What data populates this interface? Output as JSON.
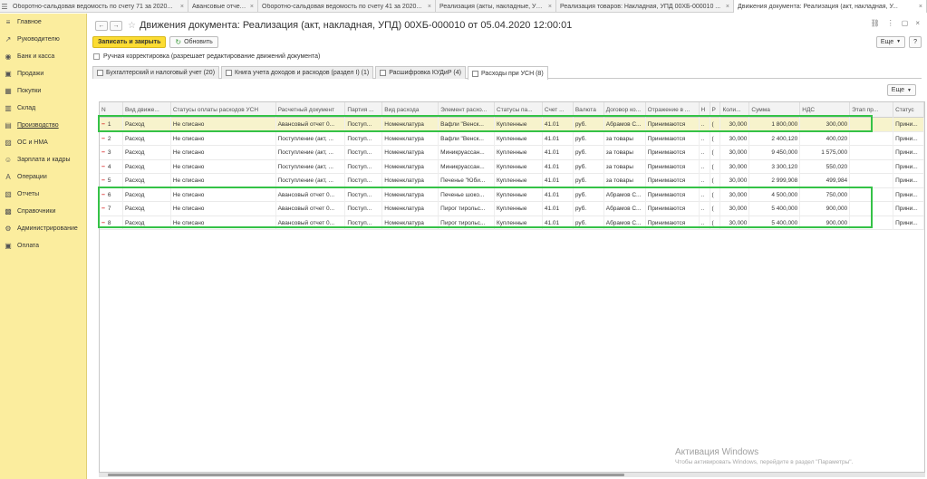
{
  "tabs": [
    {
      "label": "Оборотно-сальдовая ведомость по счету 71 за 2020..."
    },
    {
      "label": "Авансовые отчеты"
    },
    {
      "label": "Оборотно-сальдовая ведомость по счету 41 за 2020..."
    },
    {
      "label": "Реализация (акты, накладные, УПД)"
    },
    {
      "label": "Реализация товаров: Накладная, УПД 00ХБ-000010 ..."
    },
    {
      "label": "Движения документа: Реализация (акт, накладная, У..."
    }
  ],
  "sidebar": {
    "items": [
      {
        "label": "Главное",
        "icon": "≡"
      },
      {
        "label": "Руководителю",
        "icon": "↗"
      },
      {
        "label": "Банк и касса",
        "icon": "◉"
      },
      {
        "label": "Продажи",
        "icon": "▣"
      },
      {
        "label": "Покупки",
        "icon": "▦"
      },
      {
        "label": "Склад",
        "icon": "▥"
      },
      {
        "label": "Производство",
        "icon": "▤"
      },
      {
        "label": "ОС и НМА",
        "icon": "▨"
      },
      {
        "label": "Зарплата и кадры",
        "icon": "☺"
      },
      {
        "label": "Операции",
        "icon": "A"
      },
      {
        "label": "Отчеты",
        "icon": "▧"
      },
      {
        "label": "Справочники",
        "icon": "▩"
      },
      {
        "label": "Администрирование",
        "icon": "⚙"
      },
      {
        "label": "Оплата",
        "icon": "▣"
      }
    ]
  },
  "header": {
    "title": "Движения документа: Реализация (акт, накладная, УПД) 00ХБ-000010 от 05.04.2020 12:00:01"
  },
  "toolbar": {
    "save_close": "Записать и закрыть",
    "refresh": "Обновить",
    "more": "Еще",
    "help": "?"
  },
  "manual_edit_label": "Ручная корректировка (разрешает редактирование движений документа)",
  "subtabs": [
    {
      "label": "Бухгалтерский и налоговый учет (20)"
    },
    {
      "label": "Книга учета доходов и расходов (раздел I) (1)"
    },
    {
      "label": "Расшифровка КУДиР (4)"
    },
    {
      "label": "Расходы при УСН (8)"
    }
  ],
  "grid_more": "Еще",
  "table": {
    "columns": [
      "N",
      "Вид движе...",
      "Статусы оплаты расходов УСН",
      "Расчетный документ",
      "Партия ...",
      "Вид расхода",
      "Элемент расхо...",
      "Статусы па...",
      "Счет ...",
      "Валюта",
      "Договор ко...",
      "Отражение в ...",
      "Н",
      "Р",
      "Коли...",
      "Сумма",
      "НДС",
      "Этап пр...",
      "Статус"
    ],
    "rows": [
      [
        "1",
        "Расход",
        "Не списано",
        "Авансовый отчет 0...",
        "Поступ...",
        "Номенклатура",
        "Вафли \"Венск...",
        "Купленные",
        "41.01",
        "руб.",
        "Абрамов С...",
        "Принимаются",
        "..",
        "(",
        "30,000",
        "1 800,000",
        "300,000",
        "",
        "Прини..."
      ],
      [
        "2",
        "Расход",
        "Не списано",
        "Поступление (акт, ...",
        "Поступ...",
        "Номенклатура",
        "Вафли \"Венск...",
        "Купленные",
        "41.01",
        "руб.",
        "за товары",
        "Принимаются",
        "..",
        "(",
        "30,000",
        "2 400,120",
        "400,020",
        "",
        "Прини..."
      ],
      [
        "3",
        "Расход",
        "Не списано",
        "Поступление (акт, ...",
        "Поступ...",
        "Номенклатура",
        "Миникруассан...",
        "Купленные",
        "41.01",
        "руб.",
        "за товары",
        "Принимаются",
        "..",
        "(",
        "30,000",
        "9 450,000",
        "1 575,000",
        "",
        "Прини..."
      ],
      [
        "4",
        "Расход",
        "Не списано",
        "Поступление (акт, ...",
        "Поступ...",
        "Номенклатура",
        "Миникруассан...",
        "Купленные",
        "41.01",
        "руб.",
        "за товары",
        "Принимаются",
        "..",
        "(",
        "30,000",
        "3 300,120",
        "550,020",
        "",
        "Прини..."
      ],
      [
        "5",
        "Расход",
        "Не списано",
        "Поступление (акт, ...",
        "Поступ...",
        "Номенклатура",
        "Печенье \"Юби...",
        "Купленные",
        "41.01",
        "руб.",
        "за товары",
        "Принимаются",
        "..",
        "(",
        "30,000",
        "2 999,908",
        "499,984",
        "",
        "Прини..."
      ],
      [
        "6",
        "Расход",
        "Не списано",
        "Авансовый отчет 0...",
        "Поступ...",
        "Номенклатура",
        "Печенье шоко...",
        "Купленные",
        "41.01",
        "руб.",
        "Абрамов С...",
        "Принимаются",
        "..",
        "(",
        "30,000",
        "4 500,000",
        "750,000",
        "",
        "Прини..."
      ],
      [
        "7",
        "Расход",
        "Не списано",
        "Авансовый отчет 0...",
        "Поступ...",
        "Номенклатура",
        "Пирог тирольс...",
        "Купленные",
        "41.01",
        "руб.",
        "Абрамов С...",
        "Принимаются",
        "..",
        "(",
        "30,000",
        "5 400,000",
        "900,000",
        "",
        "Прини..."
      ],
      [
        "8",
        "Расход",
        "Не списано",
        "Авансовый отчет 0...",
        "Поступ...",
        "Номенклатура",
        "Пирог тирольс...",
        "Купленные",
        "41.01",
        "руб.",
        "Абрамов С...",
        "Принимаются",
        "..",
        "(",
        "30,000",
        "5 400,000",
        "900,000",
        "",
        "Прини..."
      ]
    ]
  },
  "activation": {
    "line1": "Активация Windows",
    "line2": "Чтобы активировать Windows, перейдите в раздел \"Параметры\"."
  },
  "colors": {
    "sidebar_bg": "#fbed9e",
    "primary_button": "#fcdc32",
    "highlight": "#35c247",
    "selected_row": "#f7f3cc",
    "row_marker": "#d62020"
  }
}
